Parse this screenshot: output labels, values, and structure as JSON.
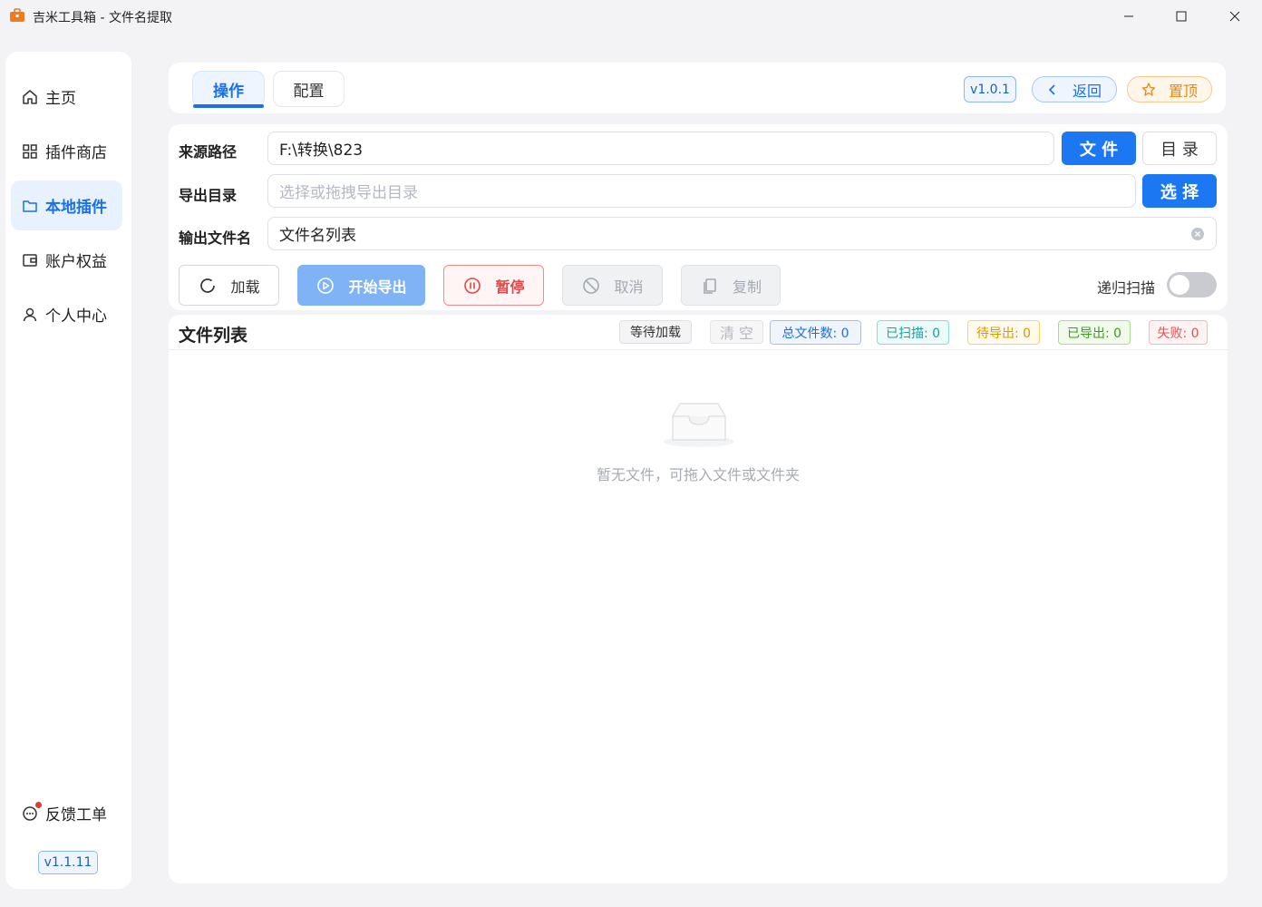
{
  "window": {
    "title": "吉米工具箱 - 文件名提取"
  },
  "sidebar": {
    "items": [
      {
        "label": "主页",
        "icon": "home-icon"
      },
      {
        "label": "插件商店",
        "icon": "grid-icon"
      },
      {
        "label": "本地插件",
        "icon": "folder-icon",
        "active": true
      },
      {
        "label": "账户权益",
        "icon": "wallet-icon"
      },
      {
        "label": "个人中心",
        "icon": "user-icon"
      }
    ],
    "feedback": {
      "label": "反馈工单",
      "icon": "chat-icon",
      "has_notification_dot": true
    },
    "version": "v1.1.11"
  },
  "header": {
    "tabs": [
      {
        "label": "操作",
        "active": true
      },
      {
        "label": "配置",
        "active": false
      }
    ],
    "version": "v1.0.1",
    "back_label": "返回",
    "pin_label": "置顶"
  },
  "form": {
    "source": {
      "label": "来源路径",
      "value": "F:\\转换\\823",
      "file_button": "文 件",
      "dir_button": "目 录"
    },
    "export_dir": {
      "label": "导出目录",
      "placeholder": "选择或拖拽导出目录",
      "select_button": "选 择"
    },
    "output_name": {
      "label": "输出文件名",
      "value": "文件名列表"
    }
  },
  "actions": {
    "load": "加载",
    "start": "开始导出",
    "pause": "暂停",
    "cancel": "取消",
    "copy": "复制",
    "recursive_label": "递归扫描",
    "recursive_on": false
  },
  "file_list": {
    "title": "文件列表",
    "wait_button": "等待加载",
    "clear_button": "清 空",
    "stats": {
      "total": "总文件数: 0",
      "scanned": "已扫描: 0",
      "pending": "待导出: 0",
      "exported": "已导出: 0",
      "failed": "失败: 0"
    },
    "empty_text": "暂无文件，可拖入文件或文件夹"
  },
  "colors": {
    "primary": "#1b78f2",
    "active_nav_bg": "#e8f2ff",
    "danger": "#e54545",
    "warning": "#e38a12",
    "notification_dot": "#e53935"
  }
}
